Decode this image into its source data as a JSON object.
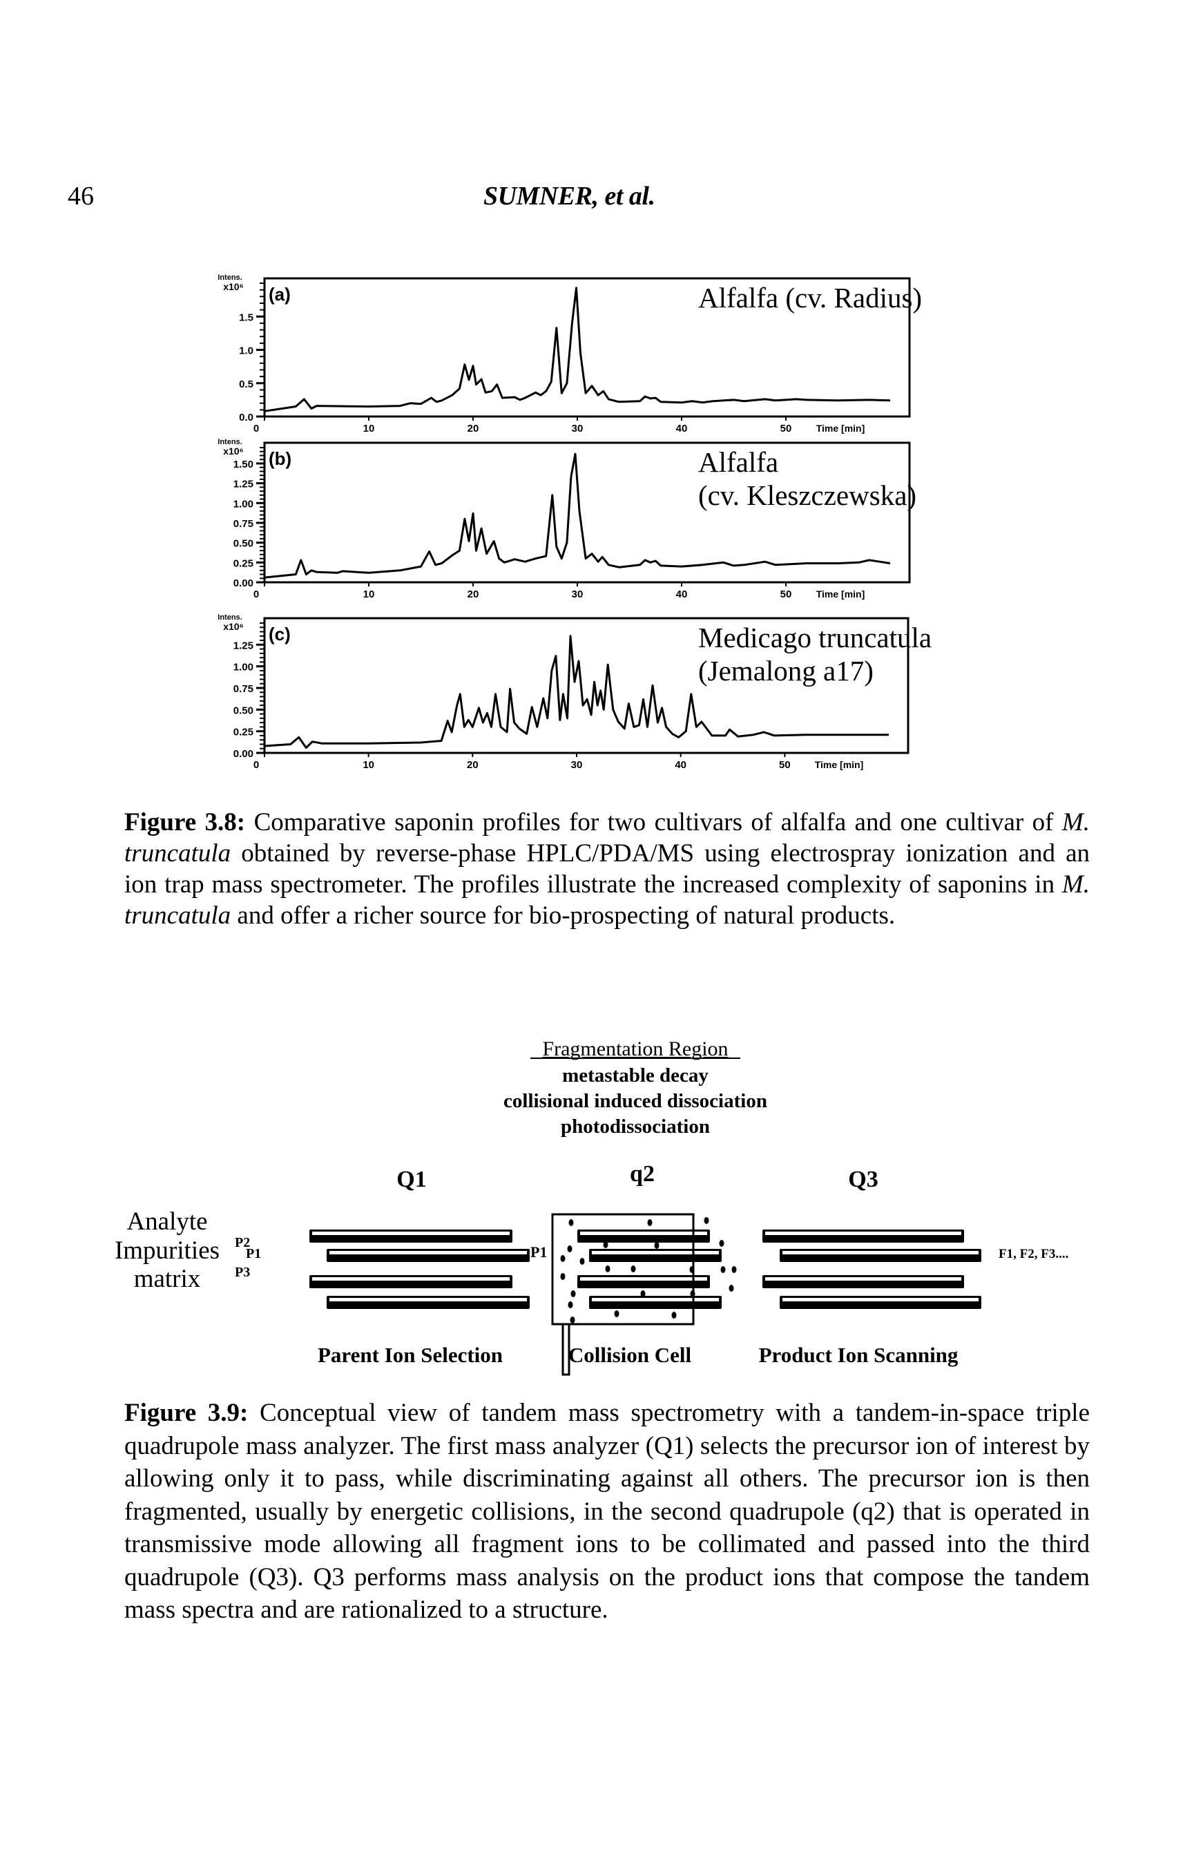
{
  "page": {
    "page_number": "46",
    "running_head": "SUMNER, et al."
  },
  "figure_3_8": {
    "caption_label": "Figure 3.8:",
    "caption_parts": [
      {
        "text": " Comparative saponin profiles for two cultivars of alfalfa and one cultivar of ",
        "italic": false
      },
      {
        "text": "M. truncatula",
        "italic": true
      },
      {
        "text": " obtained by reverse-phase HPLC/PDA/MS using electrospray ionization and an ion trap mass spectrometer. The profiles illustrate the increased complexity of saponins in ",
        "italic": false
      },
      {
        "text": "M. truncatula",
        "italic": true
      },
      {
        "text": " and offer a richer source for bio-prospecting of natural products.",
        "italic": false
      }
    ]
  },
  "chart_data": [
    {
      "type": "line",
      "panel": "(a)",
      "legend": [
        "Alfalfa (cv. Radius)"
      ],
      "ylabel": "Intens. x10^6",
      "xlabel": "Time [min]",
      "xlim": [
        0,
        60
      ],
      "ylim": [
        0,
        2.0
      ],
      "xticks": [
        0,
        10,
        20,
        30,
        40,
        50
      ],
      "yticks": [
        0.0,
        0.5,
        1.0,
        1.5
      ],
      "ytick_labels": [
        "0.0",
        "0.5",
        "1.0",
        "1.5"
      ],
      "x": [
        0,
        3,
        3.8,
        4.5,
        5,
        10,
        13,
        14,
        15,
        16,
        16.5,
        17,
        18,
        18.7,
        19.2,
        19.6,
        20,
        20.3,
        20.8,
        21.2,
        21.8,
        22.3,
        22.8,
        24,
        24.5,
        25,
        26,
        26.5,
        27,
        27.5,
        28,
        28.5,
        29,
        29.5,
        29.9,
        30.3,
        30.8,
        31.4,
        32,
        32.5,
        33,
        34,
        36,
        36.5,
        37,
        37.5,
        38,
        40,
        41,
        42,
        43,
        45,
        46,
        48,
        49,
        51,
        52,
        55,
        58,
        60
      ],
      "y": [
        0.08,
        0.15,
        0.26,
        0.12,
        0.16,
        0.15,
        0.16,
        0.2,
        0.19,
        0.28,
        0.22,
        0.24,
        0.32,
        0.42,
        0.78,
        0.55,
        0.76,
        0.48,
        0.56,
        0.36,
        0.38,
        0.48,
        0.28,
        0.29,
        0.25,
        0.28,
        0.36,
        0.32,
        0.38,
        0.52,
        1.33,
        0.35,
        0.5,
        1.4,
        1.93,
        0.95,
        0.35,
        0.46,
        0.32,
        0.38,
        0.26,
        0.22,
        0.23,
        0.3,
        0.27,
        0.28,
        0.22,
        0.21,
        0.23,
        0.21,
        0.23,
        0.25,
        0.23,
        0.26,
        0.24,
        0.26,
        0.25,
        0.24,
        0.25,
        0.24
      ]
    },
    {
      "type": "line",
      "panel": "(b)",
      "legend": [
        "Alfalfa",
        "(cv. Kleszczewska)"
      ],
      "ylabel": "Intens. x10^6",
      "xlabel": "Time [min]",
      "xlim": [
        0,
        60
      ],
      "ylim": [
        0,
        1.7
      ],
      "xticks": [
        0,
        10,
        20,
        30,
        40,
        50
      ],
      "yticks": [
        0.0,
        0.25,
        0.5,
        0.75,
        1.0,
        1.25,
        1.5
      ],
      "ytick_labels": [
        "0.00",
        "0.25",
        "0.50",
        "0.75",
        "1.00",
        "1.25",
        "1.50"
      ],
      "x": [
        0,
        3,
        3.5,
        4,
        4.5,
        5,
        7,
        7.5,
        10,
        13,
        15,
        15.8,
        16.4,
        17,
        18,
        18.7,
        19.2,
        19.6,
        20,
        20.3,
        20.8,
        21.3,
        22,
        22.5,
        23,
        24,
        25,
        26,
        27,
        27.6,
        28,
        28.5,
        29,
        29.4,
        29.8,
        30.2,
        30.8,
        31.4,
        32,
        32.4,
        33,
        34,
        36,
        36.5,
        37,
        37.5,
        38,
        40,
        42,
        44,
        45,
        46,
        48,
        49,
        52,
        55,
        57,
        58,
        60
      ],
      "y": [
        0.06,
        0.1,
        0.28,
        0.1,
        0.15,
        0.13,
        0.12,
        0.14,
        0.12,
        0.15,
        0.2,
        0.39,
        0.22,
        0.24,
        0.34,
        0.4,
        0.8,
        0.52,
        0.87,
        0.4,
        0.68,
        0.36,
        0.52,
        0.3,
        0.25,
        0.29,
        0.26,
        0.3,
        0.33,
        1.1,
        0.45,
        0.3,
        0.5,
        1.33,
        1.62,
        0.9,
        0.3,
        0.36,
        0.26,
        0.32,
        0.22,
        0.19,
        0.22,
        0.28,
        0.25,
        0.27,
        0.21,
        0.2,
        0.22,
        0.25,
        0.21,
        0.22,
        0.26,
        0.22,
        0.24,
        0.24,
        0.25,
        0.28,
        0.24
      ]
    },
    {
      "type": "line",
      "panel": "(c)",
      "legend": [
        "Medicago truncatula",
        "(Jemalong a17)"
      ],
      "ylabel": "Intens. x10^6",
      "xlabel": "Time [min]",
      "xlim": [
        0,
        60
      ],
      "ylim": [
        0,
        1.5
      ],
      "xticks": [
        0,
        10,
        20,
        30,
        40,
        50
      ],
      "yticks": [
        0.0,
        0.25,
        0.5,
        0.75,
        1.0,
        1.25
      ],
      "ytick_labels": [
        "0.00",
        "0.25",
        "0.50",
        "0.75",
        "1.00",
        "1.25"
      ],
      "x": [
        0,
        2.5,
        3.3,
        4,
        4.6,
        5.5,
        10,
        15,
        17,
        17.6,
        18,
        18.5,
        18.8,
        19.2,
        19.6,
        20,
        20.6,
        21,
        21.4,
        21.8,
        22.2,
        22.7,
        23.3,
        23.6,
        24,
        24.5,
        25.2,
        25.7,
        26.2,
        26.8,
        27.2,
        27.6,
        28,
        28.4,
        28.7,
        29.1,
        29.4,
        29.8,
        30.2,
        30.6,
        31,
        31.4,
        31.7,
        32,
        32.3,
        32.6,
        33,
        33.5,
        34,
        34.6,
        35,
        35.5,
        36,
        36.4,
        36.8,
        37.3,
        37.8,
        38.2,
        38.6,
        39.2,
        39.8,
        40.5,
        41,
        41.5,
        42,
        43,
        44.3,
        44.7,
        45.5,
        47,
        48,
        49,
        52,
        55,
        58,
        60
      ],
      "y": [
        0.08,
        0.1,
        0.18,
        0.06,
        0.13,
        0.11,
        0.11,
        0.12,
        0.14,
        0.37,
        0.24,
        0.55,
        0.68,
        0.3,
        0.38,
        0.3,
        0.52,
        0.35,
        0.46,
        0.3,
        0.68,
        0.3,
        0.24,
        0.74,
        0.35,
        0.28,
        0.22,
        0.53,
        0.3,
        0.63,
        0.4,
        0.95,
        1.12,
        0.38,
        0.68,
        0.4,
        1.35,
        0.82,
        1.06,
        0.55,
        0.62,
        0.44,
        0.82,
        0.55,
        0.72,
        0.5,
        1.02,
        0.5,
        0.36,
        0.28,
        0.57,
        0.3,
        0.32,
        0.62,
        0.3,
        0.78,
        0.35,
        0.52,
        0.3,
        0.22,
        0.18,
        0.25,
        0.68,
        0.3,
        0.36,
        0.2,
        0.2,
        0.27,
        0.19,
        0.21,
        0.24,
        0.2,
        0.21,
        0.21,
        0.21,
        0.21
      ]
    }
  ],
  "figure_3_9_diagram": {
    "region_title": "Fragmentation Region",
    "region_methods": [
      "metastable decay",
      "collisional induced dissociation",
      "photodissociation"
    ],
    "stage_labels": {
      "q1": "Q1",
      "q2": "q2",
      "q3": "Q3"
    },
    "input_labels": [
      "Analyte",
      "Impurities",
      "matrix"
    ],
    "ion_labels": {
      "p1": "P1",
      "p2": "P2",
      "p3": "P3",
      "p1_selected": "P1"
    },
    "fragment_labels": "F1, F2, F3....",
    "bottom_labels": [
      "Parent Ion Selection",
      "Collision Cell",
      "Product Ion Scanning"
    ]
  },
  "figure_3_9": {
    "caption_label": "Figure 3.9:",
    "caption_text": " Conceptual view of tandem mass spectrometry with a tandem-in-space triple quadrupole mass analyzer. The first mass analyzer (Q1) selects the precursor ion of interest by allowing only it to pass, while discriminating against all others. The precursor ion is then fragmented, usually by energetic collisions, in the second quadrupole (q2) that is operated in transmissive mode allowing all fragment ions to be collimated and passed into the third quadrupole (Q3). Q3 performs mass analysis on the product ions that compose the tandem mass spectra and are rationalized to a structure."
  }
}
